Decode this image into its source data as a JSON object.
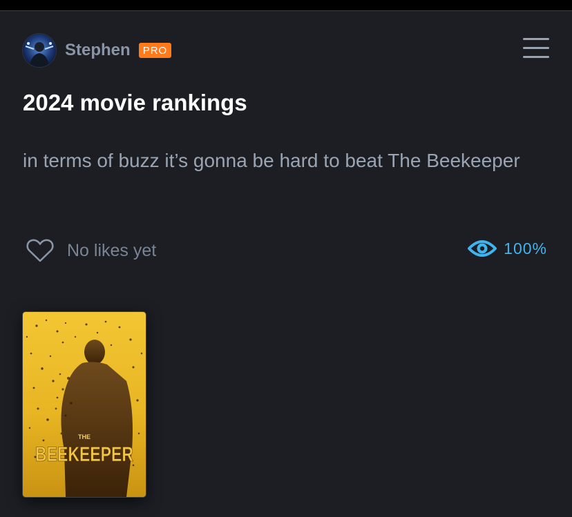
{
  "user": {
    "name": "Stephen",
    "badge": "PRO"
  },
  "list": {
    "title": "2024 movie rankings",
    "description": "in terms of buzz it’s gonna be hard to beat The Beekeeper"
  },
  "stats": {
    "likes_label": "No likes yet",
    "views_label": "100%"
  },
  "films": [
    {
      "poster_title_small": "THE",
      "poster_title_large": "BEEKEEPER"
    }
  ],
  "colors": {
    "background": "#1c1e24",
    "badge": "#ff7a1a",
    "accent": "#40b4ec",
    "poster": "#e8b523"
  },
  "icons": {
    "menu": "hamburger-menu-icon",
    "like": "heart-outline-icon",
    "views": "eye-icon"
  }
}
